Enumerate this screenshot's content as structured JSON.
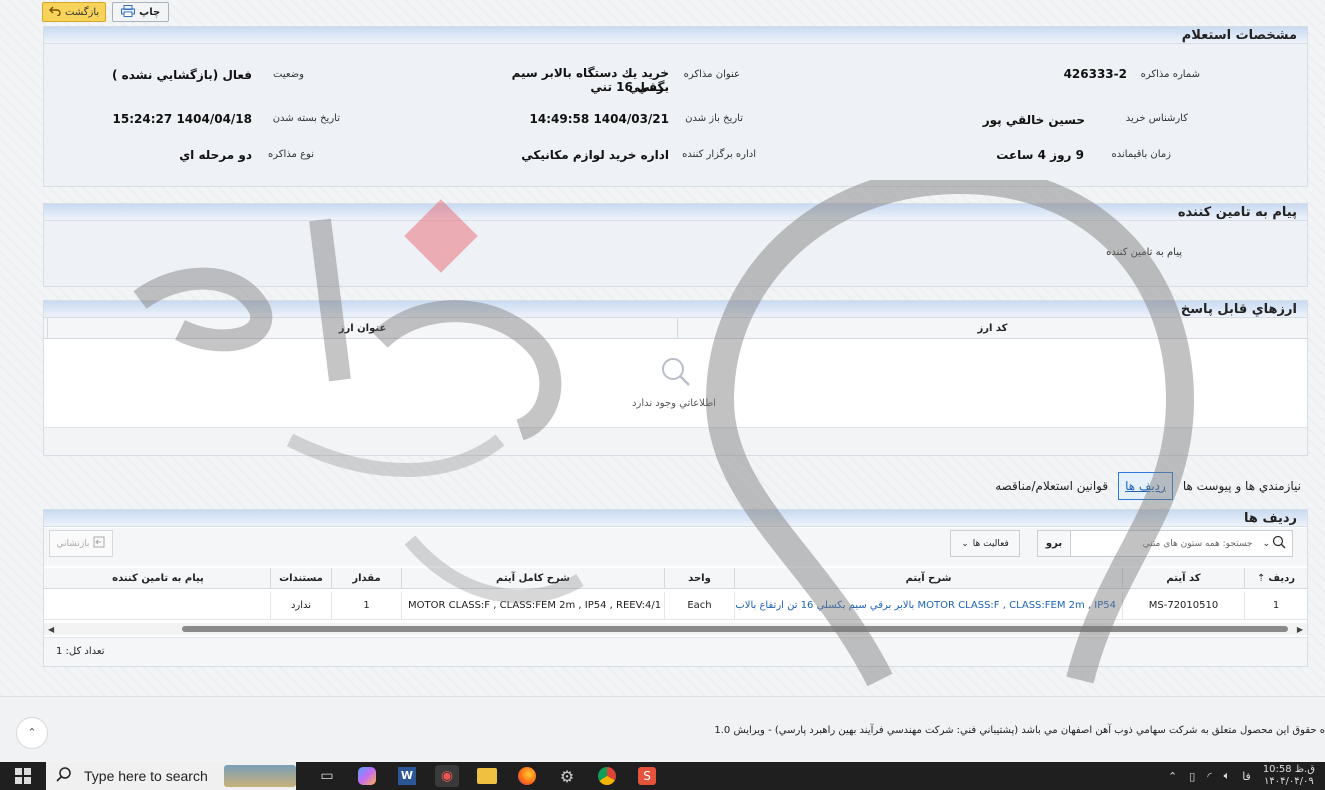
{
  "toolbar": {
    "back_label": "بازگشت",
    "print_label": "چاپ"
  },
  "specs": {
    "title": "مشخصات استعلام",
    "fields": {
      "number_label": "شماره مذاكره",
      "number_value": "426333-2",
      "subject_label": "عنوان مذاكره",
      "subject_value_1": "خريد يك دستگاه بالابر سيم بگسلي",
      "subject_value_2": "برقي 16 تني",
      "status_label": "وضعيت",
      "status_value": "فعال (بازگشايي نشده )",
      "expert_label": "كارشناس خريد",
      "expert_value": "حسين خالقي پور",
      "open_date_label": "تاريخ باز شدن",
      "open_date_value": "1404/03/21 14:49:58",
      "close_date_label": "تاريخ بسته شدن",
      "close_date_value": "1404/04/18 15:24:27",
      "remaining_label": "زمان باقيمانده",
      "remaining_value": "9 روز 4 ساعت",
      "org_label": "اداره برگزار كننده",
      "org_value": "اداره خريد لوازم مكانيكي",
      "type_label": "نوع مذاكره",
      "type_value": "دو مرحله اي"
    }
  },
  "message": {
    "title": "پيام به تامين كننده",
    "label": "پيام به تامين كننده"
  },
  "currencies": {
    "title": "ارزهاي قابل پاسخ",
    "col_code": "كد ارز",
    "col_title": "عنوان ارز",
    "empty_text": "اطلاعاتي وجود ندارد"
  },
  "tabs": [
    {
      "label": "نيازمندي ها و پيوست ها"
    },
    {
      "label": "رديف ها"
    },
    {
      "label": "قوانين استعلام/مناقصه"
    }
  ],
  "rows_panel": {
    "title": "رديف ها",
    "search_placeholder": "جستجو: همه ستون هاي متني",
    "go_label": "برو",
    "actions_label": "فعاليت ها",
    "reset_label": "بازنشاني",
    "columns": [
      "رديف",
      "كد آيتم",
      "شرح آيتم",
      "واحد",
      "شرح كامل آيتم",
      "مقدار",
      "مستندات",
      "پيام به تامين كننده"
    ],
    "row": {
      "index": "1",
      "code": "MS-72010510",
      "desc": "MOTOR CLASS:F , CLASS:FEM 2m , IP54 بالابر برقي سيم بكسلي 16 تن ارتفاع بالاب...",
      "unit": "Each",
      "full_desc": "MOTOR CLASS:F , CLASS:FEM 2m , IP54 , REEV:4/1 ...",
      "qty": "1",
      "docs": "ندارد",
      "msg": ""
    },
    "total_label": "تعداد كل: 1"
  },
  "footer": {
    "text": "ه حقوق اين محصول متعلق به شركت سهامي ذوب آهن اصفهان مي باشد (پشتيباني فني: شركت مهندسي فرآيند بهين راهبرد پارسي) - ويرايش 1.0"
  },
  "taskbar": {
    "search_placeholder": "Type here to search",
    "time": "10:58 ق.ظ",
    "date": "۱۴۰۴/۰۴/۰۹",
    "lang": "فا"
  },
  "colors": {
    "accent": "#2f7ad6",
    "header_grad": "#c9daf1",
    "link": "#1d62b8"
  }
}
